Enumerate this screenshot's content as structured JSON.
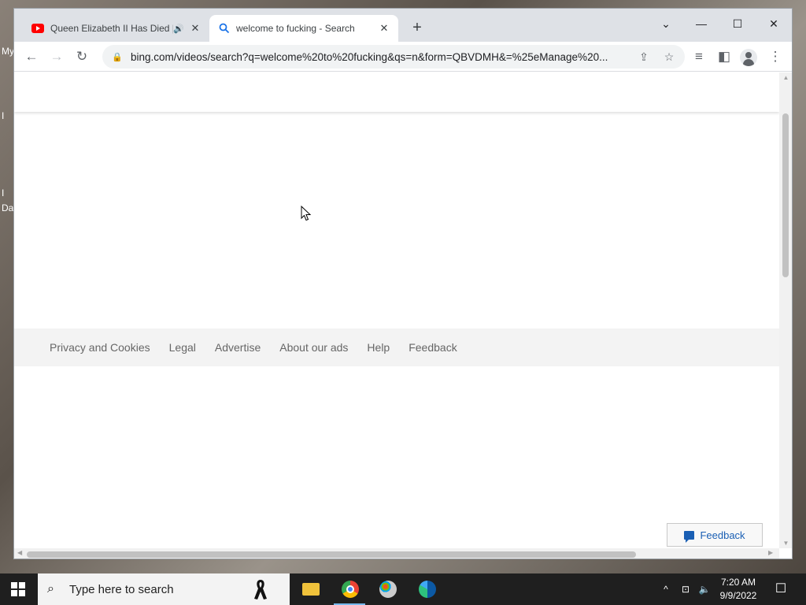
{
  "desktop": {
    "labels": [
      "My",
      "I",
      "I",
      "Da"
    ]
  },
  "browser": {
    "tabs": [
      {
        "title": "Queen Elizabeth II Has Died |",
        "favicon": "youtube-icon",
        "audio": true,
        "active": false
      },
      {
        "title": "welcome to fucking - Search",
        "favicon": "search-icon",
        "audio": false,
        "active": true
      }
    ],
    "new_tab_label": "+",
    "window_controls": {
      "minimize": "—",
      "maximize": "☐",
      "close": "✕",
      "tab_search": "⌄"
    },
    "toolbar": {
      "back": "←",
      "forward": "→",
      "reload": "↻",
      "url": "bing.com/videos/search?q=welcome%20to%20fucking&qs=n&form=QBVDMH&=%25eManage%20...",
      "share": "⇪",
      "bookmark": "☆",
      "media": "≡",
      "side_panel": "◧",
      "menu": "⋮"
    }
  },
  "page": {
    "footer_links": [
      "Privacy and Cookies",
      "Legal",
      "Advertise",
      "About our ads",
      "Help",
      "Feedback"
    ],
    "feedback_button": "Feedback"
  },
  "taskbar": {
    "search_placeholder": "Type here to search",
    "apps": [
      "file-explorer",
      "chrome",
      "paint",
      "edge"
    ],
    "tray": {
      "chevron": "^",
      "network": "⊡",
      "volume": "🔈"
    },
    "time": "7:20 AM",
    "date": "9/9/2022",
    "notification": "☐"
  },
  "colors": {
    "accent": "#1a73e8",
    "bing_link": "#1a5fb4",
    "taskbar": "#1f1f1f"
  }
}
